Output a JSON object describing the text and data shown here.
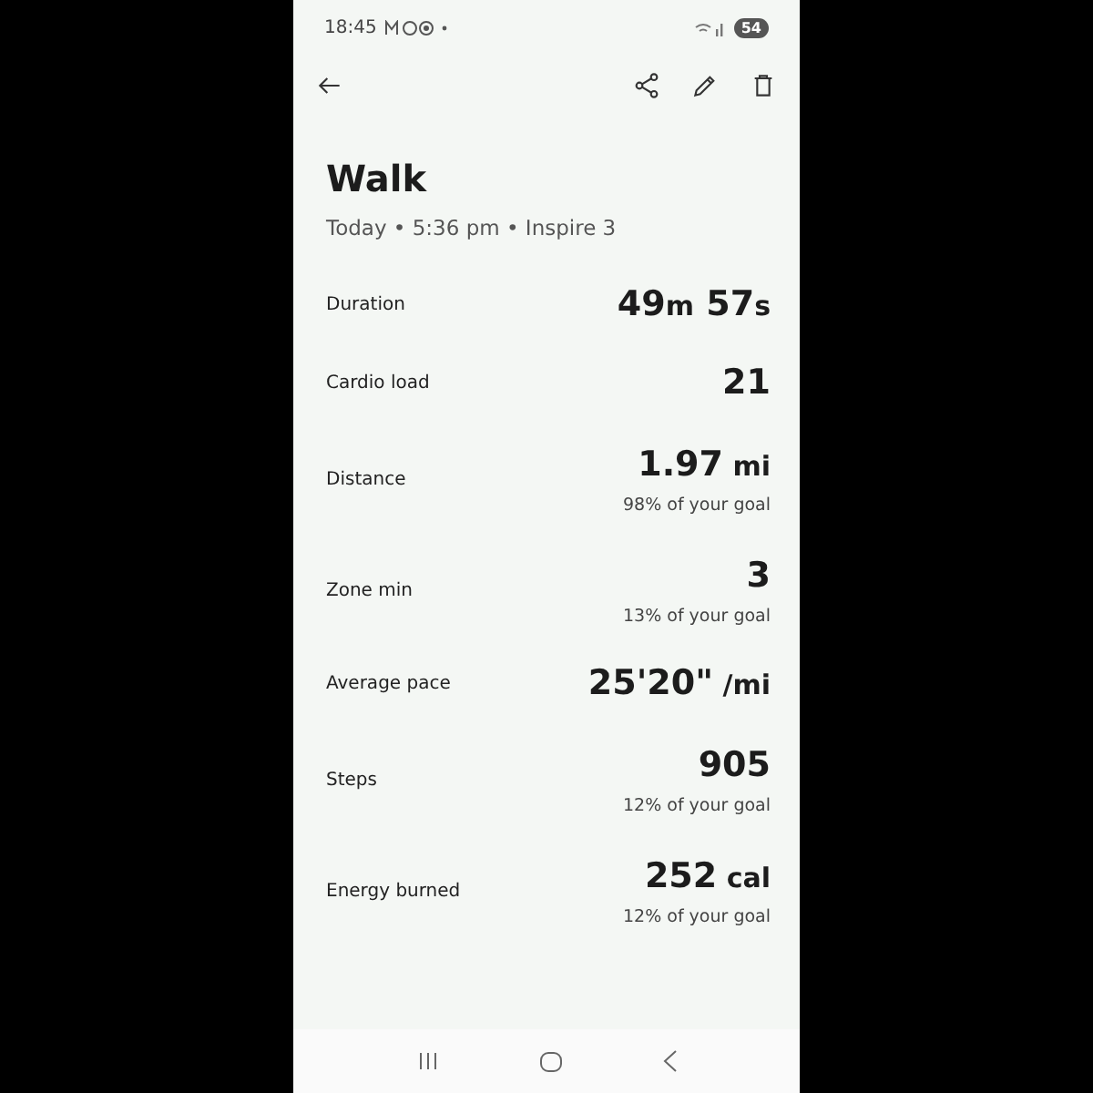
{
  "status_bar": {
    "time": "18:45",
    "battery": "54"
  },
  "activity": {
    "title": "Walk",
    "subtitle": "Today • 5:36 pm • Inspire 3"
  },
  "metrics": [
    {
      "label": "Duration",
      "value": [
        {
          "kind": "number",
          "text": "49"
        },
        {
          "kind": "unit",
          "text": "m"
        },
        {
          "kind": "number",
          "text": " 57"
        },
        {
          "kind": "unit",
          "text": "s"
        }
      ]
    },
    {
      "label": "Cardio load",
      "value": [
        {
          "kind": "number",
          "text": "21"
        }
      ]
    },
    {
      "label": "Distance",
      "value": [
        {
          "kind": "number",
          "text": "1.97"
        },
        {
          "kind": "unit",
          "text": " mi"
        }
      ],
      "goal": "98% of your goal"
    },
    {
      "label": "Zone min",
      "value": [
        {
          "kind": "number",
          "text": "3"
        }
      ],
      "goal": "13% of your goal"
    },
    {
      "label": "Average pace",
      "value": [
        {
          "kind": "number",
          "text": "25'20\""
        },
        {
          "kind": "unit",
          "text": " /mi"
        }
      ]
    },
    {
      "label": "Steps",
      "value": [
        {
          "kind": "number",
          "text": "905"
        }
      ],
      "goal": "12% of your goal"
    },
    {
      "label": "Energy burned",
      "value": [
        {
          "kind": "number",
          "text": "252"
        },
        {
          "kind": "unit",
          "text": " cal"
        }
      ],
      "goal": "12% of your goal"
    }
  ]
}
